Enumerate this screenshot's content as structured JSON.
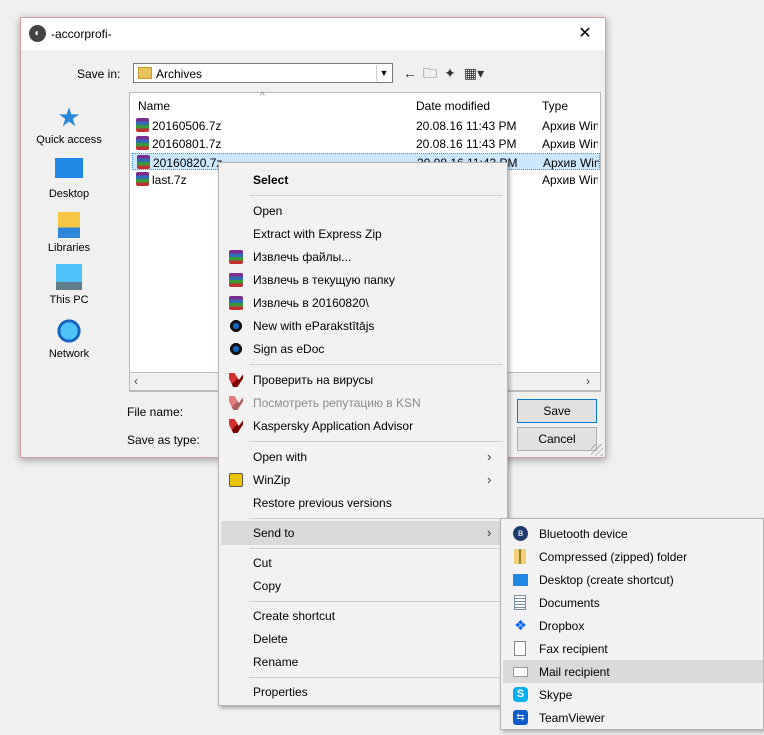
{
  "dialog": {
    "title": "-accorprofi-",
    "close": "✕",
    "save_in_label": "Save in:",
    "save_in_value": "Archives",
    "file_name_label": "File name:",
    "save_as_type_label": "Save as type:",
    "save_button": "Save",
    "cancel_button": "Cancel"
  },
  "places": [
    {
      "label": "Quick access",
      "icon": "star-icon"
    },
    {
      "label": "Desktop",
      "icon": "desktop-icon"
    },
    {
      "label": "Libraries",
      "icon": "libraries-icon"
    },
    {
      "label": "This PC",
      "icon": "computer-icon"
    },
    {
      "label": "Network",
      "icon": "network-icon"
    }
  ],
  "file_list": {
    "columns": {
      "name": "Name",
      "date": "Date modified",
      "type": "Type"
    },
    "rows": [
      {
        "name": "20160506.7z",
        "date": "20.08.16 11:43 PM",
        "type": "Архив WinRAR"
      },
      {
        "name": "20160801.7z",
        "date": "20.08.16 11:43 PM",
        "type": "Архив WinRAR"
      },
      {
        "name": "20160820.7z",
        "date": "20.08.16 11:43 PM",
        "type": "Архив WinRAR",
        "selected": true
      },
      {
        "name": "last.7z",
        "date": "",
        "type": "Архив WinRAR"
      }
    ]
  },
  "context_menu": {
    "items": [
      {
        "label": "Select",
        "bold": true
      },
      {
        "label": "Open"
      },
      {
        "label": "Extract with Express Zip"
      },
      {
        "label": "Извлечь файлы...",
        "icon": "winrar-icon"
      },
      {
        "label": "Извлечь в текущую папку",
        "icon": "winrar-icon"
      },
      {
        "label": "Извлечь в 20160820\\",
        "icon": "winrar-icon"
      },
      {
        "label": "New with eParakstītājs",
        "icon": "eparaksts-icon"
      },
      {
        "label": "Sign as eDoc",
        "icon": "eparaksts-icon"
      },
      {
        "label": "Проверить на вирусы",
        "icon": "kaspersky-icon"
      },
      {
        "label": "Посмотреть репутацию в KSN",
        "icon": "kaspersky-icon",
        "disabled": true
      },
      {
        "label": "Kaspersky Application Advisor",
        "icon": "kaspersky-icon"
      },
      {
        "label": "Open with",
        "submenu": true
      },
      {
        "label": "WinZip",
        "icon": "winzip-icon",
        "submenu": true
      },
      {
        "label": "Restore previous versions"
      },
      {
        "label": "Send to",
        "submenu": true,
        "highlighted": true
      },
      {
        "label": "Cut"
      },
      {
        "label": "Copy"
      },
      {
        "label": "Create shortcut"
      },
      {
        "label": "Delete"
      },
      {
        "label": "Rename"
      },
      {
        "label": "Properties"
      }
    ],
    "submenu_arrow": "›"
  },
  "send_to_menu": {
    "items": [
      {
        "label": "Bluetooth device",
        "icon": "bluetooth-icon"
      },
      {
        "label": "Compressed (zipped) folder",
        "icon": "zip-folder-icon"
      },
      {
        "label": "Desktop (create shortcut)",
        "icon": "desktop-icon"
      },
      {
        "label": "Documents",
        "icon": "documents-icon"
      },
      {
        "label": "Dropbox",
        "icon": "dropbox-icon"
      },
      {
        "label": "Fax recipient",
        "icon": "fax-icon"
      },
      {
        "label": "Mail recipient",
        "icon": "mail-icon",
        "highlighted": true
      },
      {
        "label": "Skype",
        "icon": "skype-icon"
      },
      {
        "label": "TeamViewer",
        "icon": "teamviewer-icon"
      }
    ]
  },
  "colors": {
    "selection": "#cce8ff",
    "menu_highlight": "#dadada",
    "accent": "#0078d7"
  }
}
